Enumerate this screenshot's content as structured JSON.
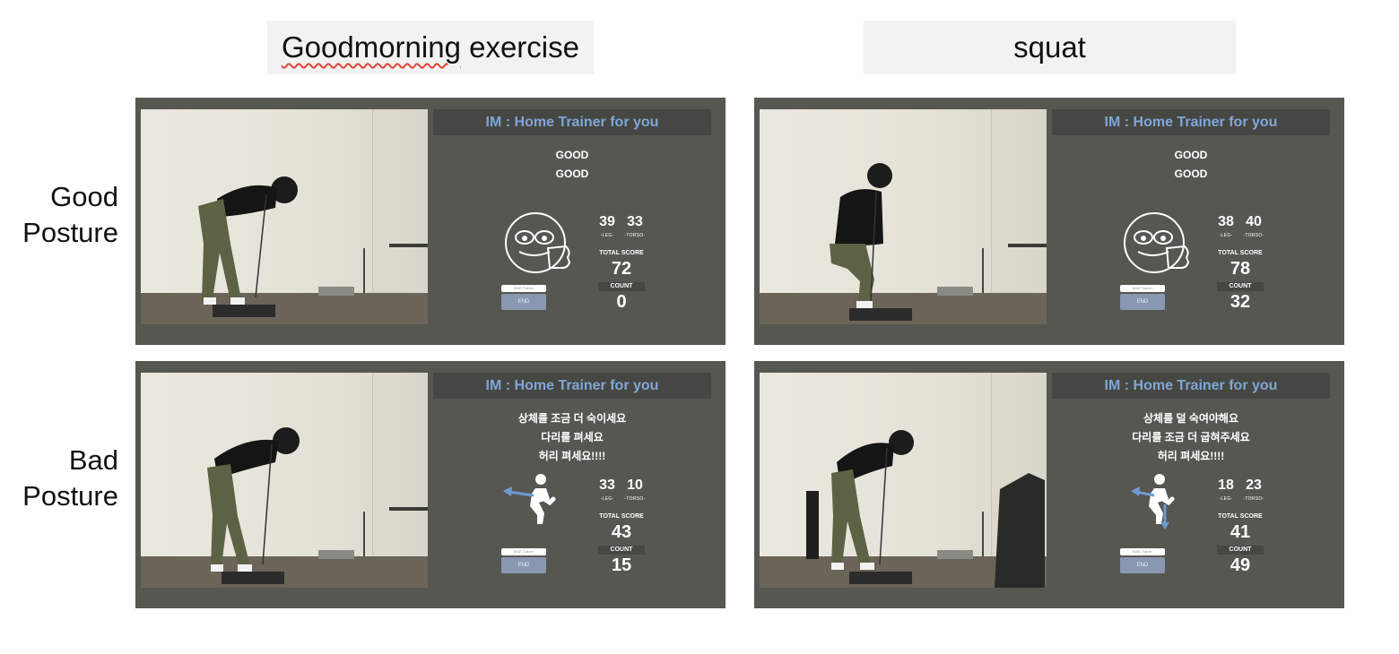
{
  "columns": [
    {
      "label_misspelled": "Goodmorning",
      "label_rest": " exercise"
    },
    {
      "label": "squat"
    }
  ],
  "rows": [
    {
      "label_line1": "Good",
      "label_line2": "Posture"
    },
    {
      "label_line1": "Bad",
      "label_line2": "Posture"
    }
  ],
  "app_title": "IM : Home Trainer for you",
  "leg_label": "-LEG-",
  "torso_label": "-TORSO-",
  "total_score_label": "TOTAL SCORE",
  "count_label": "COUNT",
  "input_placeholder": "MAE Trainer",
  "end_label": "END",
  "colors": {
    "panel": "#565751",
    "title_text": "#7fa6d9",
    "arrow": "#6f9ad1",
    "end_button": "#8a97b1"
  },
  "panels": [
    {
      "feedback": [
        "GOOD",
        "GOOD"
      ],
      "icon": "thumbs-up-emoji-icon",
      "leg": "39",
      "torso": "33",
      "total": "72",
      "count": "0"
    },
    {
      "feedback": [
        "GOOD",
        "GOOD"
      ],
      "icon": "thumbs-up-emoji-icon",
      "leg": "38",
      "torso": "40",
      "total": "78",
      "count": "32"
    },
    {
      "feedback": [
        "상체를 조금 더 숙이세요",
        "다리를 펴세요",
        "허리 펴세요!!!!"
      ],
      "icon": "posture-correction-figure-icon",
      "leg": "33",
      "torso": "10",
      "total": "43",
      "count": "15"
    },
    {
      "feedback": [
        "상체를 덜 숙여야해요",
        "다리를 조금 더 굽혀주세요",
        "허리 펴세요!!!!"
      ],
      "icon": "posture-correction-figure-icon",
      "leg": "18",
      "torso": "23",
      "total": "41",
      "count": "49"
    }
  ]
}
